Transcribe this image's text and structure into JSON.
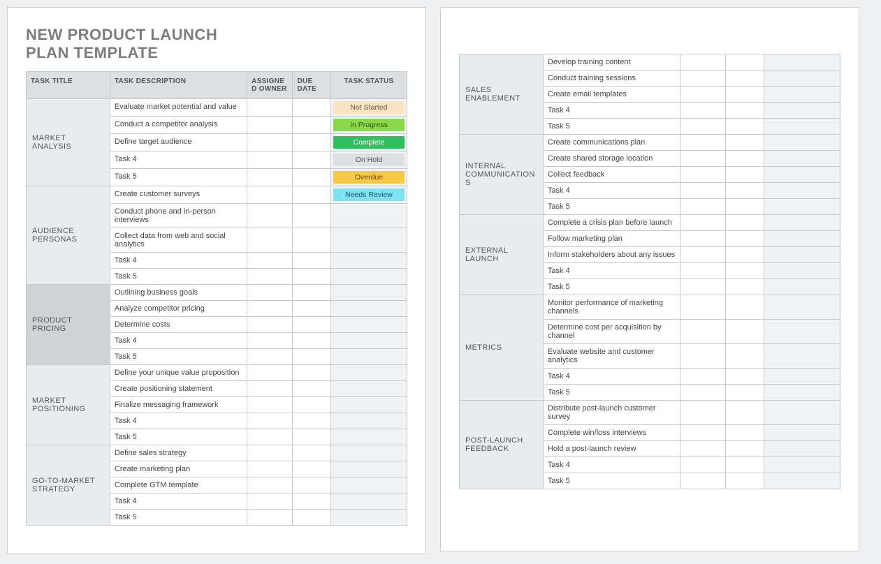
{
  "title_line1": "NEW PRODUCT LAUNCH",
  "title_line2": "PLAN TEMPLATE",
  "headers": {
    "task_title": "TASK TITLE",
    "task_description": "TASK DESCRIPTION",
    "assigned_owner": "ASSIGNED OWNER",
    "due_date": "DUE DATE",
    "task_status": "TASK STATUS"
  },
  "status_labels": {
    "not_started": "Not Started",
    "in_progress": "In Progress",
    "complete": "Complete",
    "on_hold": "On Hold",
    "overdue": "Overdue",
    "needs_review": "Needs Review"
  },
  "sections_page1": [
    {
      "title": "MARKET ANALYSIS",
      "alt": false,
      "rows": [
        {
          "desc": "Evaluate market potential and value",
          "status": "not_started"
        },
        {
          "desc": "Conduct a competitor analysis",
          "status": "in_progress"
        },
        {
          "desc": "Define target audience",
          "status": "complete"
        },
        {
          "desc": "Task 4",
          "status": "on_hold"
        },
        {
          "desc": "Task 5",
          "status": "overdue"
        }
      ]
    },
    {
      "title": "AUDIENCE PERSONAS",
      "alt": false,
      "rows": [
        {
          "desc": "Create customer surveys",
          "status": "needs_review"
        },
        {
          "desc": "Conduct phone and in-person interviews",
          "status": ""
        },
        {
          "desc": "Collect data from web and social analytics",
          "status": ""
        },
        {
          "desc": "Task 4",
          "status": ""
        },
        {
          "desc": "Task 5",
          "status": ""
        }
      ]
    },
    {
      "title": "PRODUCT PRICING",
      "alt": true,
      "rows": [
        {
          "desc": "Outlining business goals",
          "status": ""
        },
        {
          "desc": "Analyze competitor pricing",
          "status": ""
        },
        {
          "desc": "Determine costs",
          "status": ""
        },
        {
          "desc": "Task 4",
          "status": ""
        },
        {
          "desc": "Task 5",
          "status": ""
        }
      ]
    },
    {
      "title": "MARKET POSITIONING",
      "alt": false,
      "rows": [
        {
          "desc": "Define your unique value proposition",
          "status": ""
        },
        {
          "desc": "Create positioning statement",
          "status": ""
        },
        {
          "desc": "Finalize messaging framework",
          "status": ""
        },
        {
          "desc": "Task 4",
          "status": ""
        },
        {
          "desc": "Task 5",
          "status": ""
        }
      ]
    },
    {
      "title": "GO-TO-MARKET STRATEGY",
      "alt": false,
      "rows": [
        {
          "desc": "Define sales strategy",
          "status": ""
        },
        {
          "desc": "Create marketing plan",
          "status": ""
        },
        {
          "desc": "Complete GTM template",
          "status": ""
        },
        {
          "desc": "Task 4",
          "status": ""
        },
        {
          "desc": "Task 5",
          "status": ""
        }
      ]
    }
  ],
  "sections_page2": [
    {
      "title": "SALES ENABLEMENT",
      "alt": false,
      "rows": [
        {
          "desc": "Develop training content",
          "status": ""
        },
        {
          "desc": "Conduct training sessions",
          "status": ""
        },
        {
          "desc": "Create email templates",
          "status": ""
        },
        {
          "desc": "Task 4",
          "status": ""
        },
        {
          "desc": "Task 5",
          "status": ""
        }
      ]
    },
    {
      "title": "INTERNAL COMMUNICATIONS",
      "alt": false,
      "rows": [
        {
          "desc": "Create communications plan",
          "status": ""
        },
        {
          "desc": "Create shared storage location",
          "status": ""
        },
        {
          "desc": "Collect feedback",
          "status": ""
        },
        {
          "desc": "Task 4",
          "status": ""
        },
        {
          "desc": "Task 5",
          "status": ""
        }
      ]
    },
    {
      "title": "EXTERNAL LAUNCH",
      "alt": false,
      "rows": [
        {
          "desc": "Complete a crisis plan before launch",
          "status": ""
        },
        {
          "desc": "Follow marketing plan",
          "status": ""
        },
        {
          "desc": "Inform stakeholders about any issues",
          "status": ""
        },
        {
          "desc": "Task 4",
          "status": ""
        },
        {
          "desc": "Task 5",
          "status": ""
        }
      ]
    },
    {
      "title": "METRICS",
      "alt": false,
      "rows": [
        {
          "desc": "Monitor performance of marketing channels",
          "status": ""
        },
        {
          "desc": "Determine cost per acquisition by channel",
          "status": ""
        },
        {
          "desc": "Evaluate website and customer analytics",
          "status": ""
        },
        {
          "desc": "Task 4",
          "status": ""
        },
        {
          "desc": "Task 5",
          "status": ""
        }
      ]
    },
    {
      "title": "POST-LAUNCH FEEDBACK",
      "alt": false,
      "rows": [
        {
          "desc": "Distribute post-launch customer survey",
          "status": ""
        },
        {
          "desc": "Complete win/loss interviews",
          "status": ""
        },
        {
          "desc": "Hold a post-launch review",
          "status": ""
        },
        {
          "desc": "Task 4",
          "status": ""
        },
        {
          "desc": "Task 5",
          "status": ""
        }
      ]
    }
  ]
}
